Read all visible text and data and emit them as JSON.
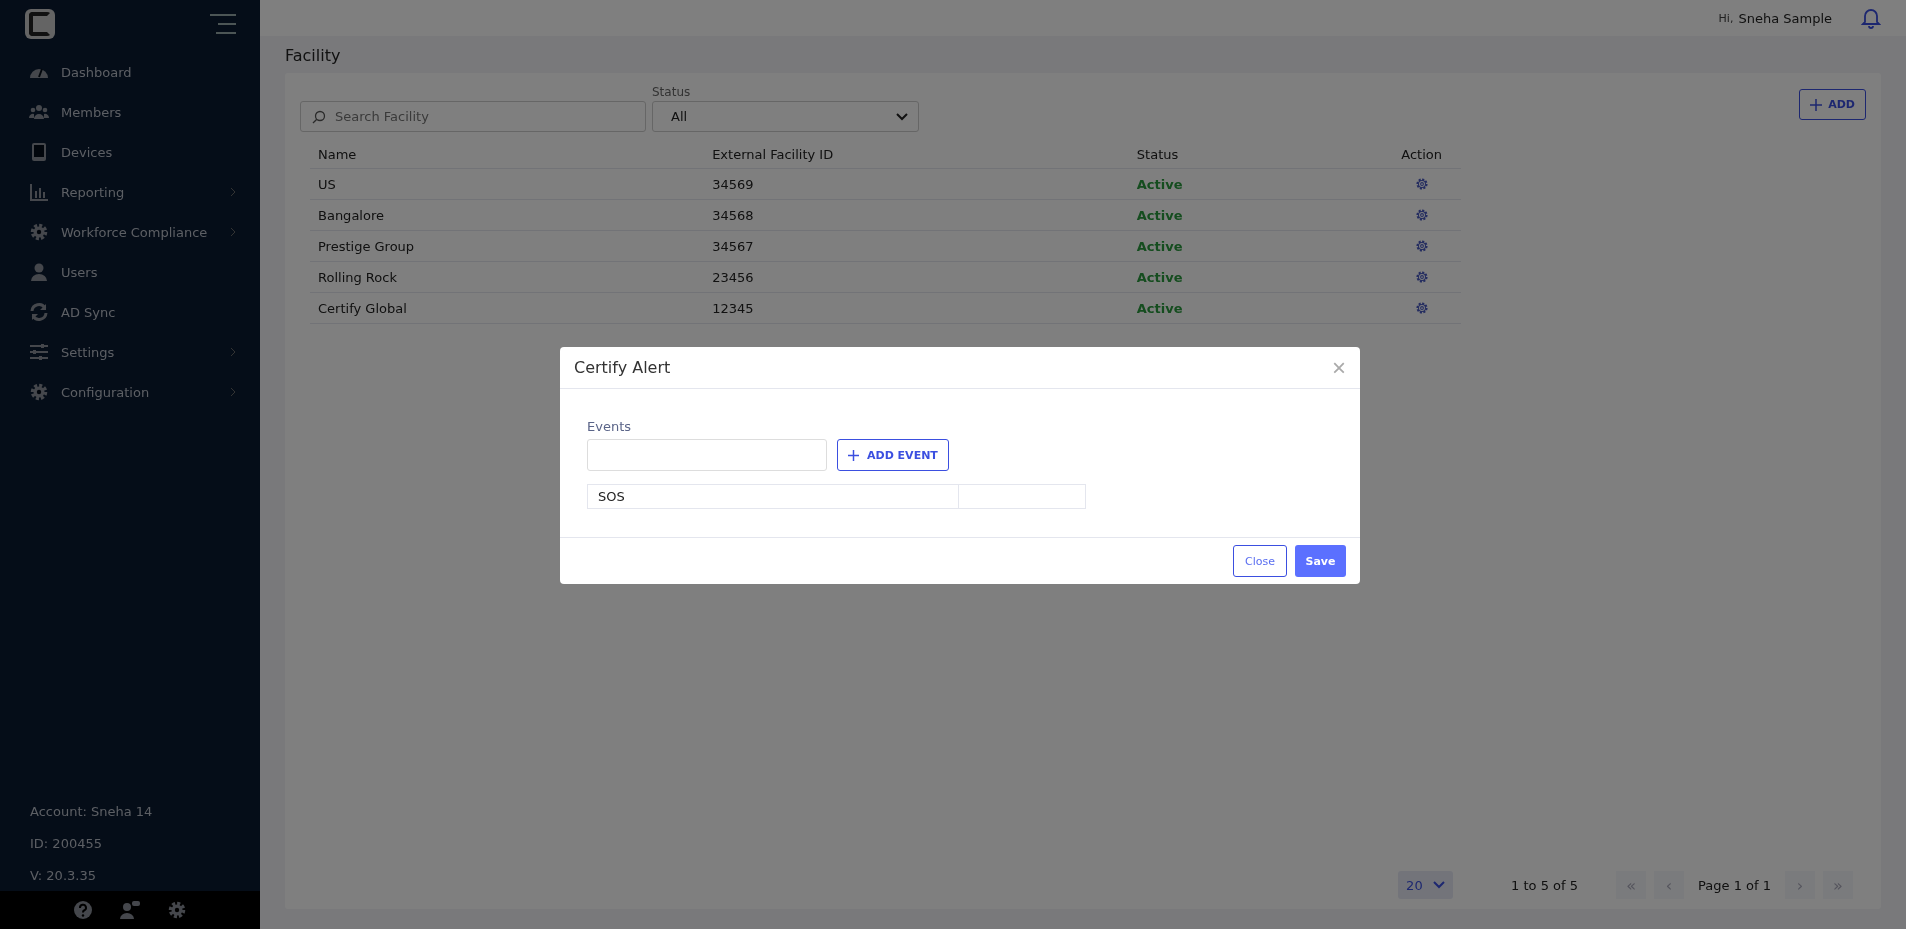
{
  "sidebar": {
    "items": [
      {
        "label": "Dashboard",
        "expandable": false
      },
      {
        "label": "Members",
        "expandable": false
      },
      {
        "label": "Devices",
        "expandable": false
      },
      {
        "label": "Reporting",
        "expandable": true
      },
      {
        "label": "Workforce Compliance",
        "expandable": true
      },
      {
        "label": "Users",
        "expandable": false
      },
      {
        "label": "AD Sync",
        "expandable": false
      },
      {
        "label": "Settings",
        "expandable": true
      },
      {
        "label": "Configuration",
        "expandable": true
      }
    ],
    "account": "Account: Sneha 14",
    "id": "ID: 200455",
    "version": "V: 20.3.35"
  },
  "header": {
    "greeting": "Hi,",
    "user": "Sneha Sample"
  },
  "page": {
    "title": "Facility",
    "search": {
      "placeholder": "Search Facility"
    },
    "status_filter": {
      "label": "Status",
      "value": "All"
    },
    "add_button": "ADD",
    "table": {
      "columns": [
        "Name",
        "External Facility ID",
        "Status",
        "Action"
      ],
      "rows": [
        {
          "name": "US",
          "external_id": "34569",
          "status": "Active"
        },
        {
          "name": "Bangalore",
          "external_id": "34568",
          "status": "Active"
        },
        {
          "name": "Prestige Group",
          "external_id": "34567",
          "status": "Active"
        },
        {
          "name": "Rolling Rock",
          "external_id": "23456",
          "status": "Active"
        },
        {
          "name": "Certify Global",
          "external_id": "12345",
          "status": "Active"
        }
      ]
    },
    "pagination": {
      "page_size": "20",
      "range": "1 to 5 of 5",
      "page": "Page 1 of 1",
      "first": "«",
      "prev": "‹",
      "next": "›",
      "last": "»"
    }
  },
  "modal": {
    "title": "Certify Alert",
    "close_icon": "×",
    "events_label": "Events",
    "add_event_button": "ADD EVENT",
    "events": [
      {
        "name": "SOS"
      }
    ],
    "buttons": {
      "close": "Close",
      "save": "Save"
    }
  }
}
